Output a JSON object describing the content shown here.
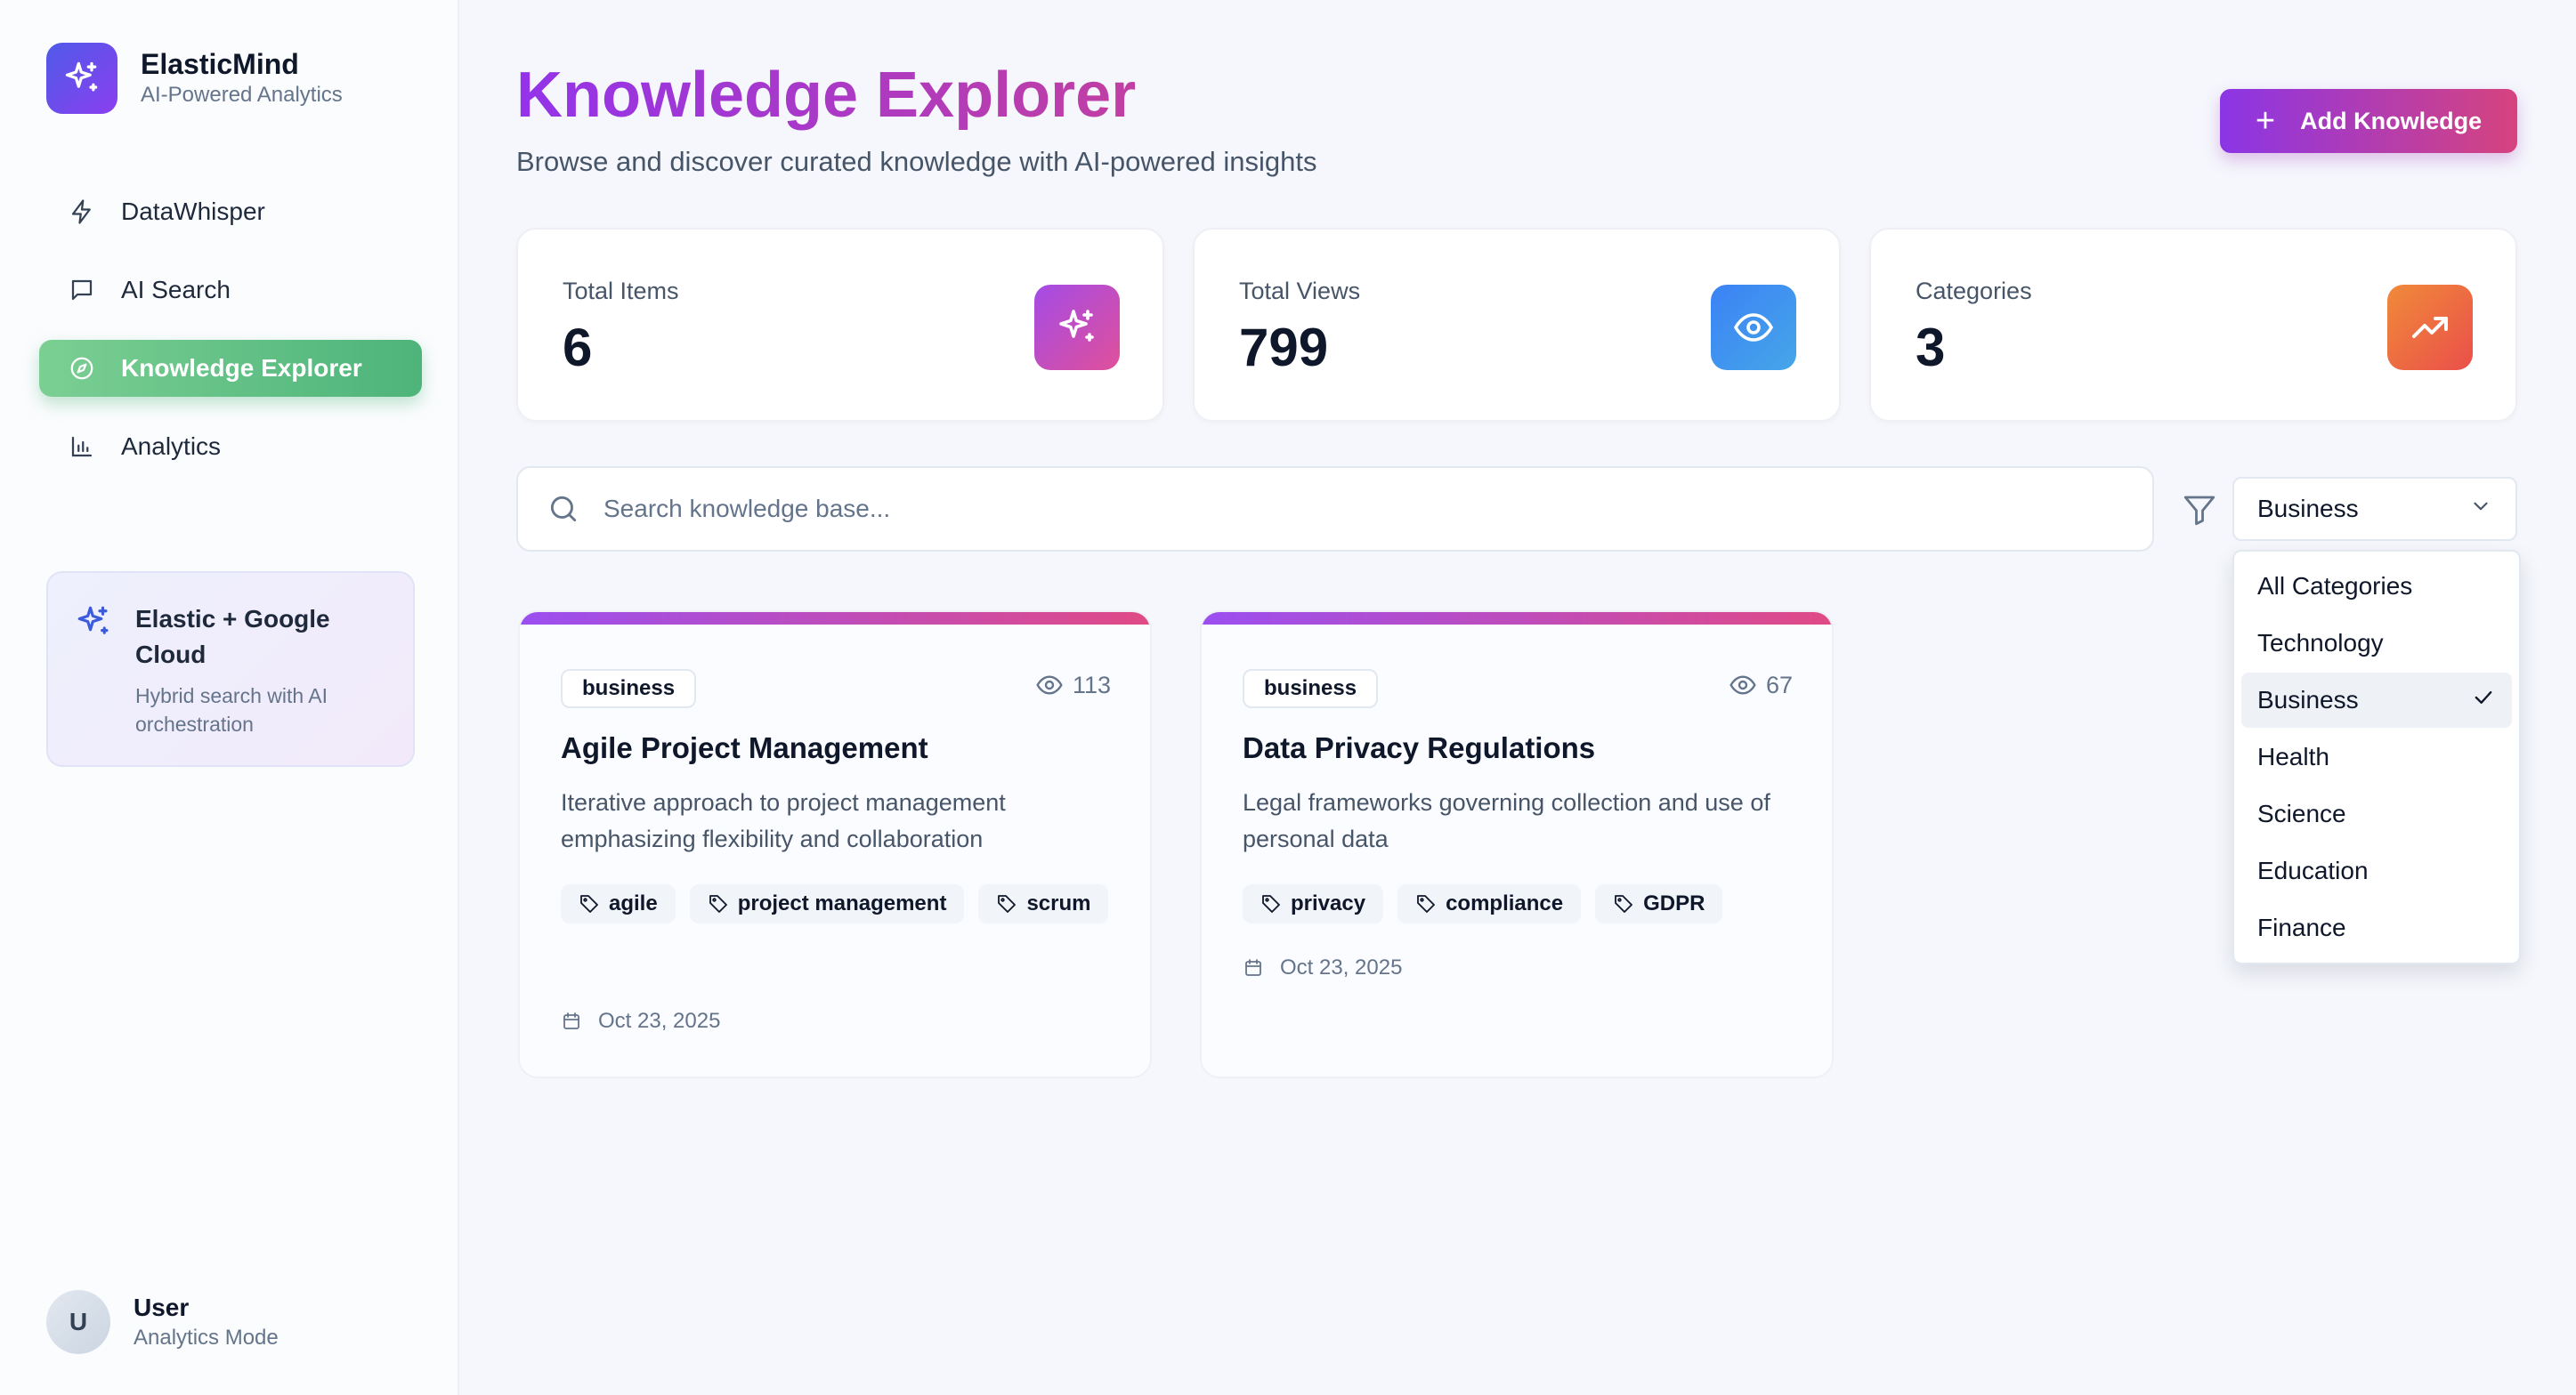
{
  "brand": {
    "name": "ElasticMind",
    "subtitle": "AI-Powered Analytics"
  },
  "nav": [
    {
      "label": "DataWhisper",
      "icon": "bolt-icon"
    },
    {
      "label": "AI Search",
      "icon": "message-icon"
    },
    {
      "label": "Knowledge Explorer",
      "icon": "compass-icon",
      "active": true
    },
    {
      "label": "Analytics",
      "icon": "bar-chart-icon"
    }
  ],
  "promo": {
    "title": "Elastic + Google Cloud",
    "description": "Hybrid search with AI orchestration"
  },
  "user": {
    "initial": "U",
    "name": "User",
    "mode": "Analytics Mode"
  },
  "header": {
    "title": "Knowledge Explorer",
    "subtitle": "Browse and discover curated knowledge with AI-powered insights",
    "add_button": "Add Knowledge"
  },
  "stats": [
    {
      "label": "Total Items",
      "value": "6",
      "icon": "sparkles-icon"
    },
    {
      "label": "Total Views",
      "value": "799",
      "icon": "eye-icon"
    },
    {
      "label": "Categories",
      "value": "3",
      "icon": "trending-up-icon"
    }
  ],
  "search": {
    "placeholder": "Search knowledge base..."
  },
  "filter": {
    "selected": "Business",
    "options": [
      "All Categories",
      "Technology",
      "Business",
      "Health",
      "Science",
      "Education",
      "Finance"
    ]
  },
  "cards": [
    {
      "category": "business",
      "views": "113",
      "title": "Agile Project Management",
      "description": "Iterative approach to project management emphasizing flexibility and collaboration",
      "tags": [
        "agile",
        "project management",
        "scrum"
      ],
      "date": "Oct 23, 2025"
    },
    {
      "category": "business",
      "views": "67",
      "title": "Data Privacy Regulations",
      "description": "Legal frameworks governing collection and use of personal data",
      "tags": [
        "privacy",
        "compliance",
        "GDPR"
      ],
      "date": "Oct 23, 2025"
    }
  ],
  "colors": {
    "accent_purple": "#9333ea",
    "accent_pink": "#d6437e",
    "active_nav_green": "#5dbd83",
    "views_icon_blue": "#3b82f6",
    "categories_icon_orange": "#f06a3a"
  }
}
